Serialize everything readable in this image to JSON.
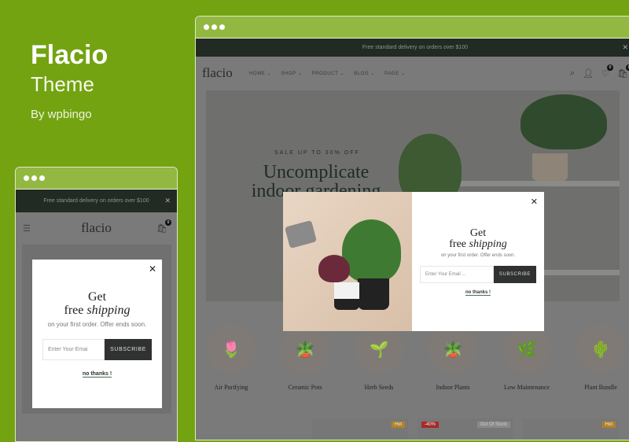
{
  "brand": {
    "name": "Flacio",
    "subtitle": "Theme",
    "author": "By wpbingo"
  },
  "colors": {
    "background": "#73a311",
    "titlebar": "#92b842",
    "promo_bar": "#222a24",
    "subscribe_button": "#2f3230",
    "hot_badge": "#b0822a",
    "discount_badge": "#a52a2a"
  },
  "desktop": {
    "promo": "Free standard delivery on orders over $100",
    "logo": "flacio",
    "nav": [
      "HOME",
      "SHOP",
      "PRODUCT",
      "BLOG",
      "PAGE"
    ],
    "wishlist_count": "0",
    "cart_count": "0",
    "hero": {
      "sale": "SALE UP TO 30% OFF",
      "headline": "Uncomplicate indoor gardening"
    },
    "categories": [
      "Air Purifying",
      "Ceramic Pots",
      "Herb Seeds",
      "Indoor Plants",
      "Low Maintenance",
      "Plant Bundle"
    ],
    "category_icons": [
      "🌷",
      "🪴",
      "🌱",
      "🪴",
      "🌿",
      "🌵"
    ],
    "product_tags": [
      {
        "label": "Hot"
      },
      {
        "label": "-40%",
        "secondary": "Out Of Stock"
      },
      {
        "label": "Hot"
      }
    ]
  },
  "popup": {
    "line1": "Get",
    "line2a": "free",
    "line2b": "shipping",
    "subtitle": "on your first order. Offer ends soon.",
    "email_placeholder": "Enter Your Email ...",
    "subscribe": "SUBSCRIBE",
    "no_thanks": "no thanks !",
    "close": "✕"
  },
  "mobile": {
    "promo": "Free standard delivery on orders over $100",
    "logo": "flacio",
    "cart_count": "0",
    "email_placeholder": "Enter Your Emai"
  }
}
